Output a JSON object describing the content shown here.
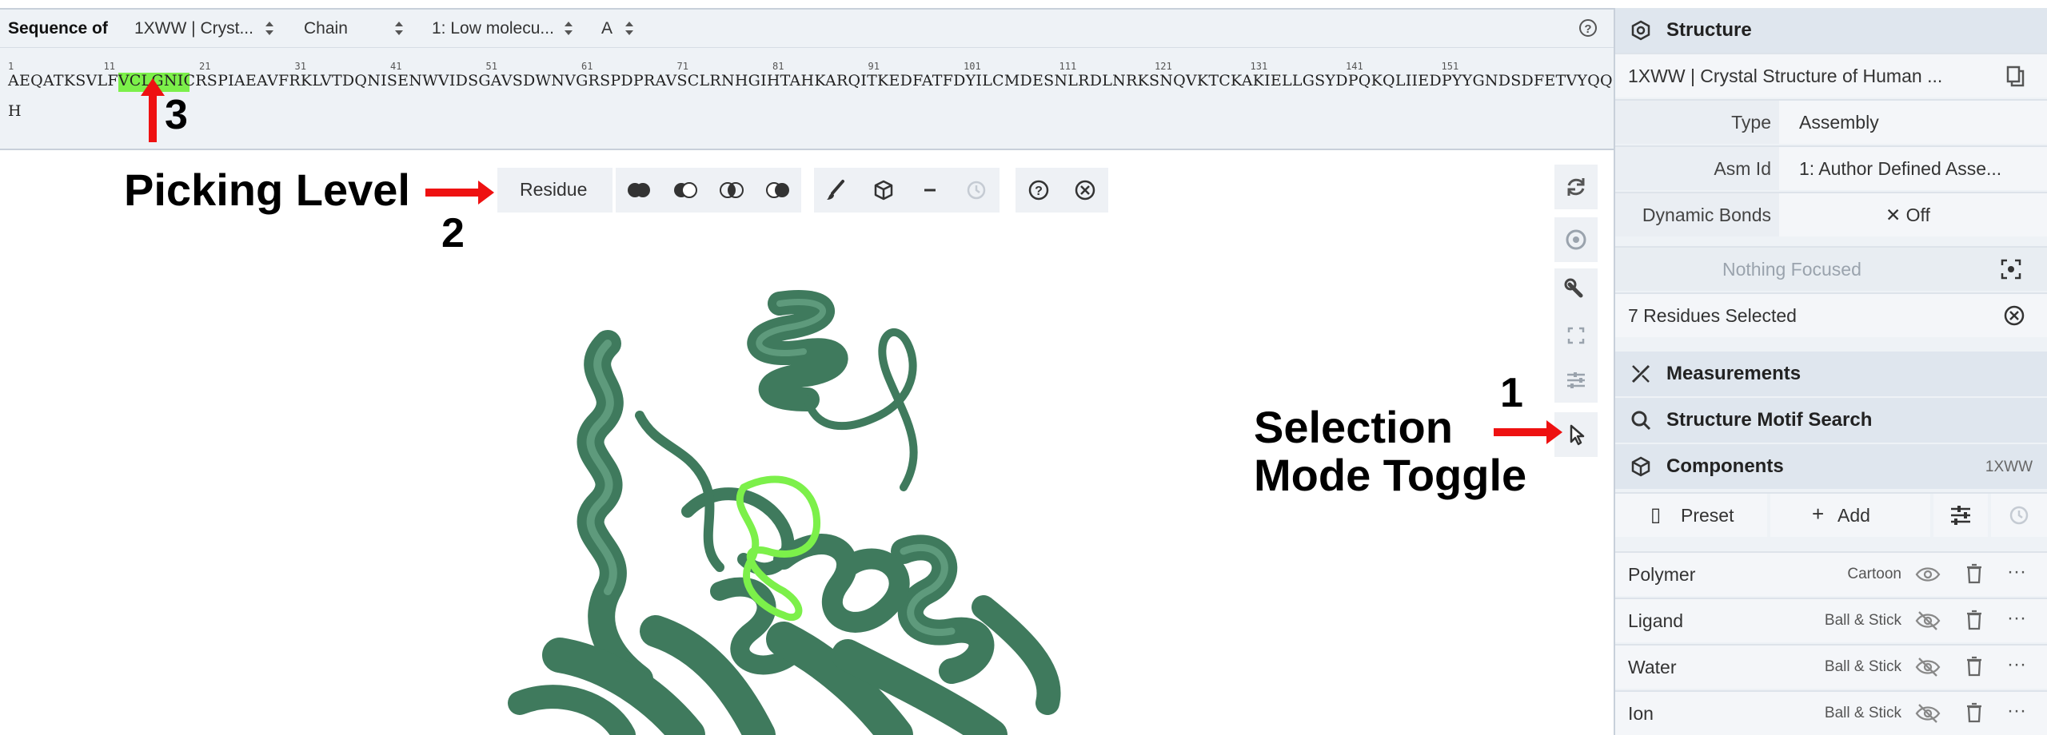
{
  "sequence_panel": {
    "label": "Sequence of",
    "entry_select": "1XWW | Cryst...",
    "mode_select": "Chain",
    "entity_select": "1: Low molecu...",
    "chain_select": "A",
    "numbers": [
      "1",
      "11",
      "21",
      "31",
      "41",
      "51",
      "61",
      "71",
      "81",
      "91",
      "101",
      "111",
      "121",
      "131",
      "141",
      "151"
    ],
    "seq_before": "AEQATKSVLFV",
    "seq_selected": "CLGNICR",
    "seq_after": "SPIAEAVFRKLVTDQNISENWVIDSGAVSDWNVGRSPDPRAVSCLRNHGIHTAHKARQITKEDFATFDYILCMDESNLRDLNRKSNQVKTCKAKIELLGSYDPQKQLIIEDPYYGNDSDFETVYQQCVRCCRAFLEKA",
    "seq_line2": "H"
  },
  "viewport_toolbar": {
    "picking_level": "Residue"
  },
  "annotations": {
    "picking_level": "Picking Level",
    "num1": "1",
    "num2": "2",
    "num3": "3",
    "selection_mode_1": "Selection",
    "selection_mode_2": "Mode Toggle"
  },
  "right_panel": {
    "structure_title": "Structure",
    "entry": "1XWW | Crystal Structure of Human ...",
    "type_label": "Type",
    "type_value": "Assembly",
    "asm_label": "Asm Id",
    "asm_value": "1: Author Defined Asse...",
    "bonds_label": "Dynamic Bonds",
    "bonds_value": "Off",
    "focus": "Nothing Focused",
    "selected": "7 Residues Selected",
    "measurements": "Measurements",
    "motif": "Structure Motif Search",
    "components": "Components",
    "components_tag": "1XWW",
    "preset": "Preset",
    "add": "Add",
    "rows": [
      {
        "name": "Polymer",
        "repr": "Cartoon"
      },
      {
        "name": "Ligand",
        "repr": "Ball & Stick"
      },
      {
        "name": "Water",
        "repr": "Ball & Stick"
      },
      {
        "name": "Ion",
        "repr": "Ball & Stick"
      }
    ]
  },
  "colors": {
    "protein": "#3f7a5d",
    "highlight": "#7cf04a",
    "arrow": "#ee1111"
  }
}
